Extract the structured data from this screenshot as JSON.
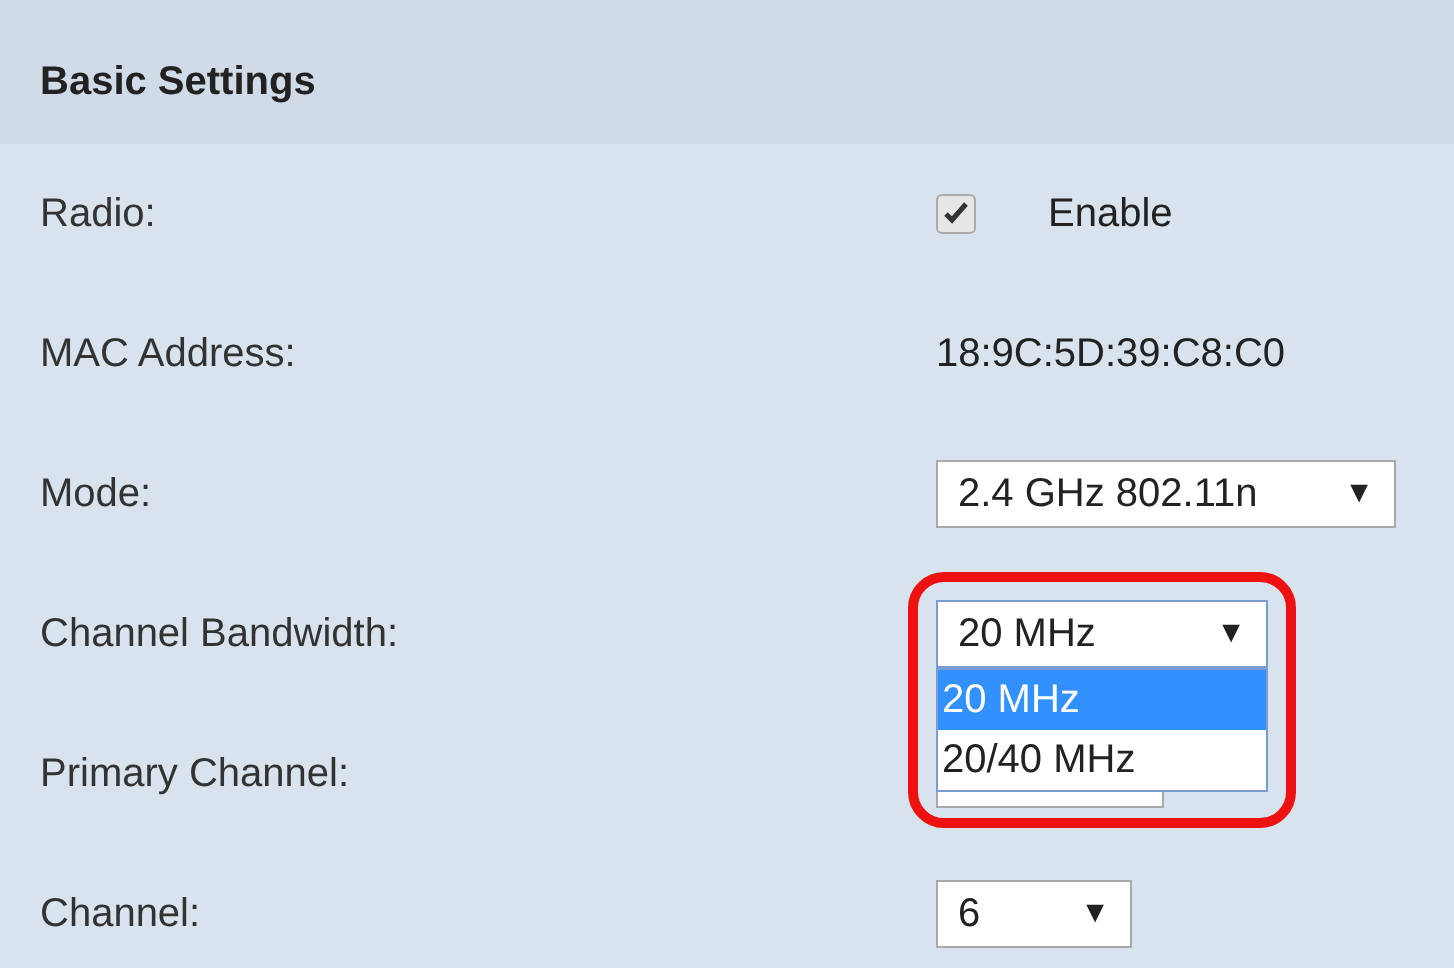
{
  "section": {
    "title": "Basic Settings"
  },
  "rows": [
    {
      "label": "Radio:",
      "kind": "checkbox",
      "checked": true,
      "text": "Enable"
    },
    {
      "label": "MAC Address:",
      "kind": "text",
      "text": "18:9C:5D:39:C8:C0"
    },
    {
      "label": "Mode:",
      "kind": "select",
      "value": "2.4 GHz 802.11n",
      "arrow": "▼"
    },
    {
      "label": "Channel Bandwidth:",
      "kind": "select",
      "value": "20 MHz",
      "arrow": "▼",
      "expanded": true,
      "highlighted": true,
      "options": [
        {
          "label": "20 MHz",
          "selected": true
        },
        {
          "label": "20/40 MHz",
          "selected": false
        }
      ]
    },
    {
      "label": "Primary Channel:",
      "kind": "hidden-select"
    },
    {
      "label": "Channel:",
      "kind": "select",
      "value": "6",
      "arrow": "▼"
    }
  ]
}
